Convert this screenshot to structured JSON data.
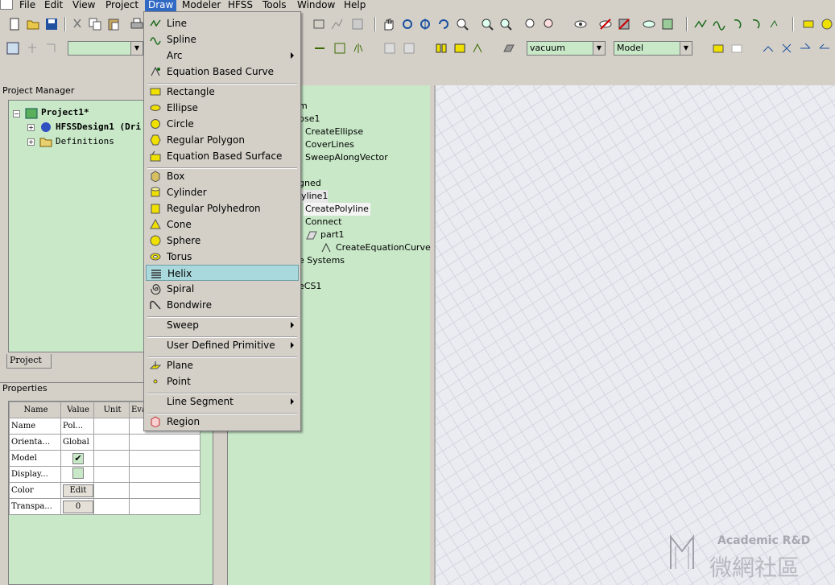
{
  "menubar": {
    "items": [
      "File",
      "Edit",
      "View",
      "Project",
      "Draw",
      "Modeler",
      "HFSS",
      "Tools",
      "Window",
      "Help"
    ]
  },
  "toolbar": {
    "material_combo": "vacuum",
    "view_combo": "Model"
  },
  "project_manager": {
    "title": "Project Manager",
    "project": "Project1*",
    "design": "HFSSDesign1 (Dri",
    "definitions": "Definitions",
    "tab": "Project"
  },
  "modeler_tree": {
    "nodes": [
      "m",
      "pse1",
      "CreateEllipse",
      "CoverLines",
      "SweepAlongVector",
      "gned",
      "lyline1",
      "CreatePolyline",
      "Connect",
      "part1",
      "CreateEquationCurve",
      "e Systems",
      "eCS1"
    ]
  },
  "properties": {
    "title": "Properties",
    "headers": [
      "Name",
      "Value",
      "Unit",
      "Eva"
    ],
    "rows": [
      {
        "name": "Name",
        "value": "Pol..."
      },
      {
        "name": "Orienta...",
        "value": "Global"
      },
      {
        "name": "Model",
        "value": "✔"
      },
      {
        "name": "Display...",
        "value": ""
      },
      {
        "name": "Color",
        "value": "Edit"
      },
      {
        "name": "Transpa...",
        "value": "0"
      }
    ]
  },
  "draw_menu": {
    "items": [
      {
        "label": "Line",
        "icon": "line-icon"
      },
      {
        "label": "Spline",
        "icon": "spline-icon"
      },
      {
        "label": "Arc",
        "icon": "arc-icon",
        "submenu": true
      },
      {
        "label": "Equation Based Curve",
        "icon": "equation-curve-icon"
      },
      {
        "label": "Rectangle",
        "icon": "rectangle-icon"
      },
      {
        "label": "Ellipse",
        "icon": "ellipse-icon"
      },
      {
        "label": "Circle",
        "icon": "circle-icon"
      },
      {
        "label": "Regular Polygon",
        "icon": "polygon-icon"
      },
      {
        "label": "Equation Based Surface",
        "icon": "equation-surface-icon"
      },
      {
        "label": "Box",
        "icon": "box-icon"
      },
      {
        "label": "Cylinder",
        "icon": "cylinder-icon"
      },
      {
        "label": "Regular Polyhedron",
        "icon": "polyhedron-icon"
      },
      {
        "label": "Cone",
        "icon": "cone-icon"
      },
      {
        "label": "Sphere",
        "icon": "sphere-icon"
      },
      {
        "label": "Torus",
        "icon": "torus-icon"
      },
      {
        "label": "Helix",
        "icon": "helix-icon"
      },
      {
        "label": "Spiral",
        "icon": "spiral-icon"
      },
      {
        "label": "Bondwire",
        "icon": "bondwire-icon"
      },
      {
        "label": "Sweep",
        "submenu": true
      },
      {
        "label": "User Defined Primitive",
        "submenu": true
      },
      {
        "label": "Plane",
        "icon": "plane-icon"
      },
      {
        "label": "Point",
        "icon": "point-icon"
      },
      {
        "label": "Line Segment",
        "submenu": true
      },
      {
        "label": "Region",
        "icon": "region-icon"
      }
    ]
  },
  "watermark": {
    "line1": "Academic R&D",
    "line2": "微網社區"
  }
}
